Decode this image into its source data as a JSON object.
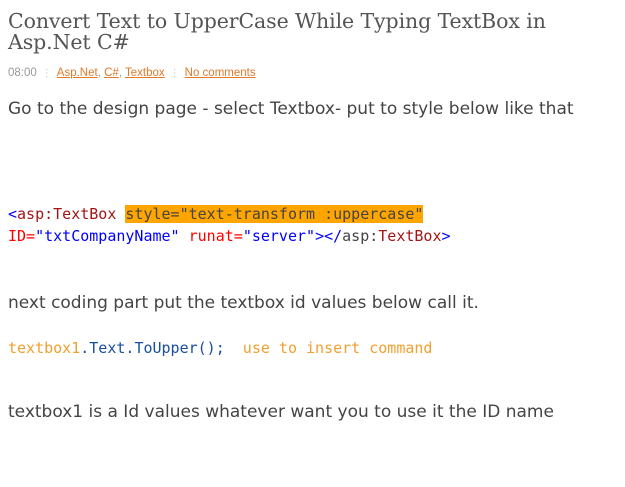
{
  "post": {
    "title": "Convert Text to UpperCase While Typing TextBox in Asp.Net C#",
    "time": "08:00",
    "labels": [
      "Asp.Net",
      "C#",
      "Textbox"
    ],
    "label_separator": ",",
    "comments": "No comments",
    "intro": "Go to the design page - select Textbox- put to style below like that",
    "code_line1": {
      "open": "<",
      "tag": "asp:TextBox",
      "space": " ",
      "highlighted_attr": "style=\"text-transform :uppercase\""
    },
    "code_line2": {
      "id_attr": "ID=",
      "id_val": "\"txtCompanyName\"",
      "runat_attr": " runat=",
      "runat_val": "\"server\"",
      "close": "></",
      "close_ns": "asp:",
      "close_tag": "TextBox",
      "end": ">"
    },
    "next_text": "next coding part put the textbox id values below call it.",
    "code_line3": {
      "obj": "textbox1",
      "dot1": ".",
      "prop": "Text",
      "dot2": ".",
      "method": "ToUpper();",
      "comment": "  use to insert command"
    },
    "last_text": "textbox1 is a Id values whatever want you to use it the ID name"
  },
  "colors": {
    "highlight": "#ffa500",
    "link": "#e07a2c",
    "code_blue": "#0000ff",
    "code_red": "#ff0000",
    "code_brown": "#a31515"
  }
}
